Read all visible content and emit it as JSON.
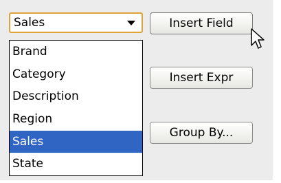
{
  "field_select": {
    "value": "Sales",
    "options": [
      "Brand",
      "Category",
      "Description",
      "Region",
      "Sales",
      "State"
    ],
    "selected_index": 4
  },
  "buttons": {
    "insert_field": "Insert Field",
    "insert_expr": "Insert Expr",
    "group_by": "Group By..."
  },
  "colors": {
    "selection": "#3165c4",
    "focus_border": "#e1a23a"
  },
  "icons": {
    "dropdown": "chevron-down-icon",
    "cursor": "arrow-cursor-icon"
  }
}
